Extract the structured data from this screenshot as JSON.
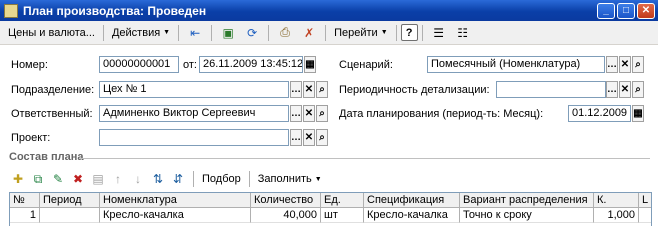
{
  "window": {
    "title": "План производства: Проведен"
  },
  "toolbar": {
    "prices_label": "Цены и валюта...",
    "actions_label": "Действия",
    "goto_label": "Перейти",
    "help_label": "?"
  },
  "form": {
    "number_label": "Номер:",
    "number_value": "00000000001",
    "date_label": "от:",
    "date_value": "26.11.2009 13:45:12",
    "division_label": "Подразделение:",
    "division_value": "Цех № 1",
    "responsible_label": "Ответственный:",
    "responsible_value": "Админенко Виктор Сергеевич",
    "project_label": "Проект:",
    "project_value": "",
    "scenario_label": "Сценарий:",
    "scenario_value": "Помесячный (Номенклатура)",
    "periodicity_label": "Периодичность детализации:",
    "periodicity_value": "",
    "planning_date_label": "Дата планирования (период-ть: Месяц):",
    "planning_date_value": "01.12.2009"
  },
  "section": {
    "title": "Состав плана"
  },
  "table_toolbar": {
    "pick_label": "Подбор",
    "fill_label": "Заполнить"
  },
  "table": {
    "columns": [
      "№",
      "Период",
      "Номенклатура",
      "Количество",
      "Ед.",
      "Спецификация",
      "Вариант распределения",
      "К.",
      "L"
    ],
    "rows": [
      [
        "1",
        "",
        "Кресло-качалка",
        "40,000",
        "шт",
        "Кресло-качалка",
        "Точно к сроку",
        "1,000",
        ""
      ]
    ]
  }
}
